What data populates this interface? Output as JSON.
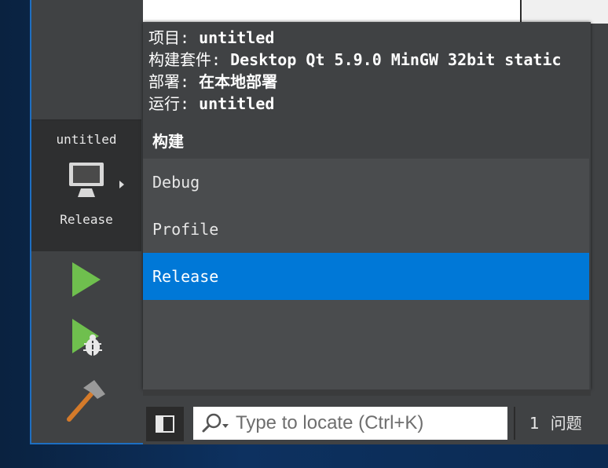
{
  "colors": {
    "accent": "#0078d7",
    "run_green": "#6fbf4e",
    "panel": "#404244"
  },
  "target": {
    "project": "untitled",
    "config": "Release"
  },
  "popup": {
    "info": [
      {
        "label": "项目: ",
        "value": "untitled"
      },
      {
        "label": "构建套件: ",
        "value": "Desktop Qt 5.9.0 MinGW 32bit static"
      },
      {
        "label": "部署: ",
        "value": "在本地部署"
      },
      {
        "label": "运行: ",
        "value": "untitled"
      }
    ],
    "section_title": "构建",
    "configs": [
      "Debug",
      "Profile",
      "Release"
    ],
    "selected": "Release"
  },
  "status": {
    "locator_placeholder": "Type to locate (Ctrl+K)",
    "issues_count": "1",
    "issues_label": "问题"
  },
  "icons": {
    "target": "monitor-icon",
    "run": "run-icon",
    "debug": "debug-run-icon",
    "build": "hammer-icon",
    "search": "search-icon",
    "toggle": "sidebar-toggle-icon"
  }
}
